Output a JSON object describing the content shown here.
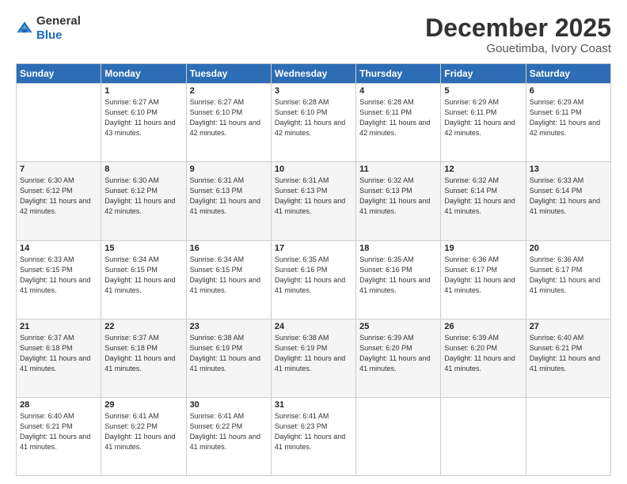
{
  "header": {
    "logo_general": "General",
    "logo_blue": "Blue",
    "title": "December 2025",
    "subtitle": "Gouetimba, Ivory Coast"
  },
  "days_of_week": [
    "Sunday",
    "Monday",
    "Tuesday",
    "Wednesday",
    "Thursday",
    "Friday",
    "Saturday"
  ],
  "weeks": [
    [
      {
        "day": "",
        "sunrise": "",
        "sunset": "",
        "daylight": ""
      },
      {
        "day": "1",
        "sunrise": "Sunrise: 6:27 AM",
        "sunset": "Sunset: 6:10 PM",
        "daylight": "Daylight: 11 hours and 43 minutes."
      },
      {
        "day": "2",
        "sunrise": "Sunrise: 6:27 AM",
        "sunset": "Sunset: 6:10 PM",
        "daylight": "Daylight: 11 hours and 42 minutes."
      },
      {
        "day": "3",
        "sunrise": "Sunrise: 6:28 AM",
        "sunset": "Sunset: 6:10 PM",
        "daylight": "Daylight: 11 hours and 42 minutes."
      },
      {
        "day": "4",
        "sunrise": "Sunrise: 6:28 AM",
        "sunset": "Sunset: 6:11 PM",
        "daylight": "Daylight: 11 hours and 42 minutes."
      },
      {
        "day": "5",
        "sunrise": "Sunrise: 6:29 AM",
        "sunset": "Sunset: 6:11 PM",
        "daylight": "Daylight: 11 hours and 42 minutes."
      },
      {
        "day": "6",
        "sunrise": "Sunrise: 6:29 AM",
        "sunset": "Sunset: 6:11 PM",
        "daylight": "Daylight: 11 hours and 42 minutes."
      }
    ],
    [
      {
        "day": "7",
        "sunrise": "Sunrise: 6:30 AM",
        "sunset": "Sunset: 6:12 PM",
        "daylight": "Daylight: 11 hours and 42 minutes."
      },
      {
        "day": "8",
        "sunrise": "Sunrise: 6:30 AM",
        "sunset": "Sunset: 6:12 PM",
        "daylight": "Daylight: 11 hours and 42 minutes."
      },
      {
        "day": "9",
        "sunrise": "Sunrise: 6:31 AM",
        "sunset": "Sunset: 6:13 PM",
        "daylight": "Daylight: 11 hours and 41 minutes."
      },
      {
        "day": "10",
        "sunrise": "Sunrise: 6:31 AM",
        "sunset": "Sunset: 6:13 PM",
        "daylight": "Daylight: 11 hours and 41 minutes."
      },
      {
        "day": "11",
        "sunrise": "Sunrise: 6:32 AM",
        "sunset": "Sunset: 6:13 PM",
        "daylight": "Daylight: 11 hours and 41 minutes."
      },
      {
        "day": "12",
        "sunrise": "Sunrise: 6:32 AM",
        "sunset": "Sunset: 6:14 PM",
        "daylight": "Daylight: 11 hours and 41 minutes."
      },
      {
        "day": "13",
        "sunrise": "Sunrise: 6:33 AM",
        "sunset": "Sunset: 6:14 PM",
        "daylight": "Daylight: 11 hours and 41 minutes."
      }
    ],
    [
      {
        "day": "14",
        "sunrise": "Sunrise: 6:33 AM",
        "sunset": "Sunset: 6:15 PM",
        "daylight": "Daylight: 11 hours and 41 minutes."
      },
      {
        "day": "15",
        "sunrise": "Sunrise: 6:34 AM",
        "sunset": "Sunset: 6:15 PM",
        "daylight": "Daylight: 11 hours and 41 minutes."
      },
      {
        "day": "16",
        "sunrise": "Sunrise: 6:34 AM",
        "sunset": "Sunset: 6:15 PM",
        "daylight": "Daylight: 11 hours and 41 minutes."
      },
      {
        "day": "17",
        "sunrise": "Sunrise: 6:35 AM",
        "sunset": "Sunset: 6:16 PM",
        "daylight": "Daylight: 11 hours and 41 minutes."
      },
      {
        "day": "18",
        "sunrise": "Sunrise: 6:35 AM",
        "sunset": "Sunset: 6:16 PM",
        "daylight": "Daylight: 11 hours and 41 minutes."
      },
      {
        "day": "19",
        "sunrise": "Sunrise: 6:36 AM",
        "sunset": "Sunset: 6:17 PM",
        "daylight": "Daylight: 11 hours and 41 minutes."
      },
      {
        "day": "20",
        "sunrise": "Sunrise: 6:36 AM",
        "sunset": "Sunset: 6:17 PM",
        "daylight": "Daylight: 11 hours and 41 minutes."
      }
    ],
    [
      {
        "day": "21",
        "sunrise": "Sunrise: 6:37 AM",
        "sunset": "Sunset: 6:18 PM",
        "daylight": "Daylight: 11 hours and 41 minutes."
      },
      {
        "day": "22",
        "sunrise": "Sunrise: 6:37 AM",
        "sunset": "Sunset: 6:18 PM",
        "daylight": "Daylight: 11 hours and 41 minutes."
      },
      {
        "day": "23",
        "sunrise": "Sunrise: 6:38 AM",
        "sunset": "Sunset: 6:19 PM",
        "daylight": "Daylight: 11 hours and 41 minutes."
      },
      {
        "day": "24",
        "sunrise": "Sunrise: 6:38 AM",
        "sunset": "Sunset: 6:19 PM",
        "daylight": "Daylight: 11 hours and 41 minutes."
      },
      {
        "day": "25",
        "sunrise": "Sunrise: 6:39 AM",
        "sunset": "Sunset: 6:20 PM",
        "daylight": "Daylight: 11 hours and 41 minutes."
      },
      {
        "day": "26",
        "sunrise": "Sunrise: 6:39 AM",
        "sunset": "Sunset: 6:20 PM",
        "daylight": "Daylight: 11 hours and 41 minutes."
      },
      {
        "day": "27",
        "sunrise": "Sunrise: 6:40 AM",
        "sunset": "Sunset: 6:21 PM",
        "daylight": "Daylight: 11 hours and 41 minutes."
      }
    ],
    [
      {
        "day": "28",
        "sunrise": "Sunrise: 6:40 AM",
        "sunset": "Sunset: 6:21 PM",
        "daylight": "Daylight: 11 hours and 41 minutes."
      },
      {
        "day": "29",
        "sunrise": "Sunrise: 6:41 AM",
        "sunset": "Sunset: 6:22 PM",
        "daylight": "Daylight: 11 hours and 41 minutes."
      },
      {
        "day": "30",
        "sunrise": "Sunrise: 6:41 AM",
        "sunset": "Sunset: 6:22 PM",
        "daylight": "Daylight: 11 hours and 41 minutes."
      },
      {
        "day": "31",
        "sunrise": "Sunrise: 6:41 AM",
        "sunset": "Sunset: 6:23 PM",
        "daylight": "Daylight: 11 hours and 41 minutes."
      },
      {
        "day": "",
        "sunrise": "",
        "sunset": "",
        "daylight": ""
      },
      {
        "day": "",
        "sunrise": "",
        "sunset": "",
        "daylight": ""
      },
      {
        "day": "",
        "sunrise": "",
        "sunset": "",
        "daylight": ""
      }
    ]
  ]
}
